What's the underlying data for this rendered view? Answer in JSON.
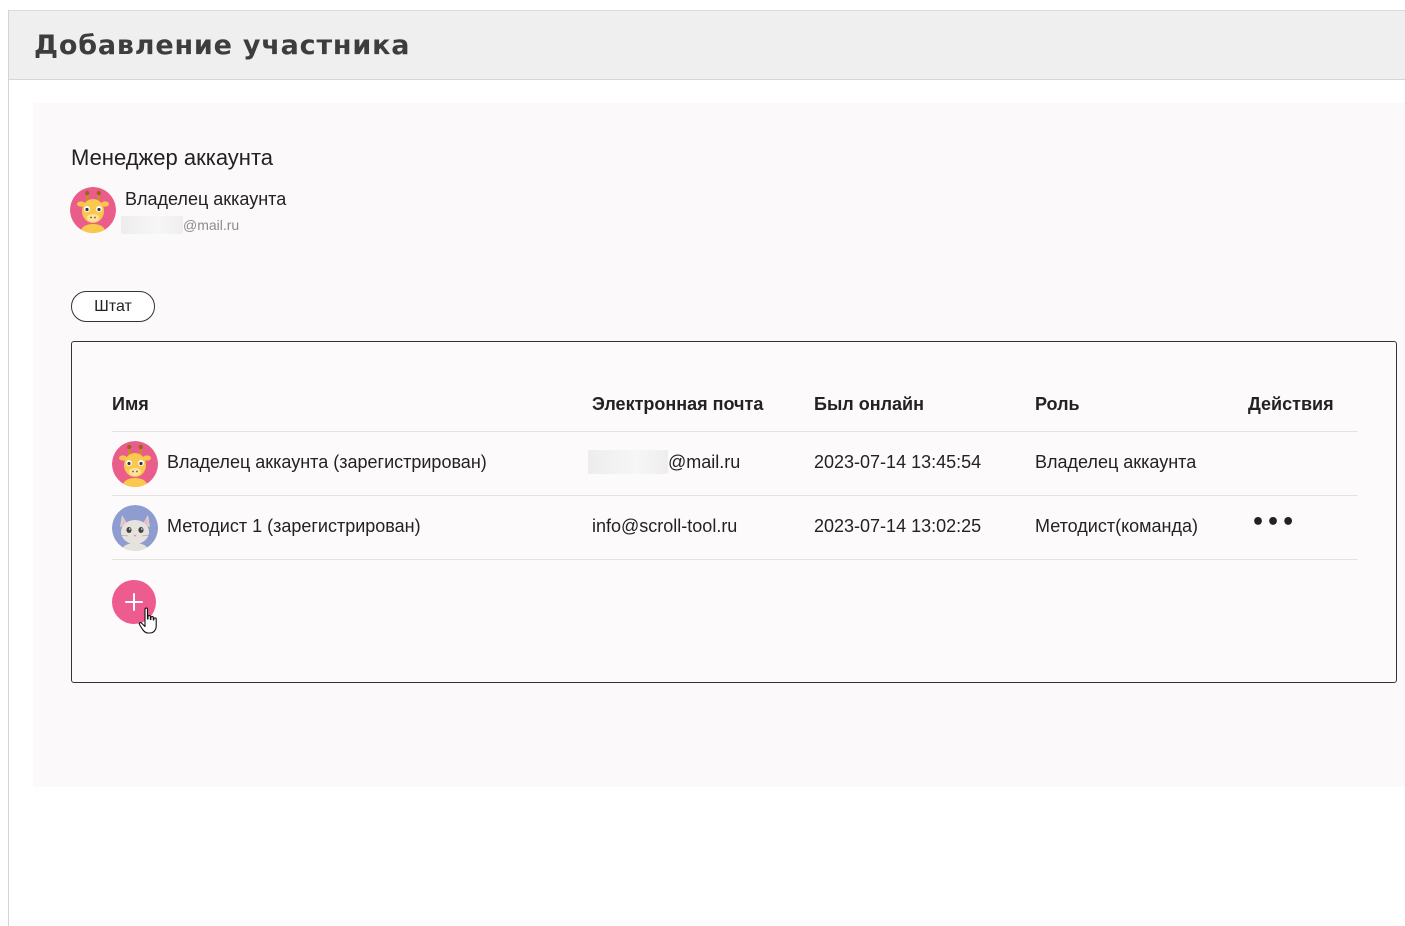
{
  "header": {
    "title": "Добавление участника"
  },
  "manager": {
    "section_title": "Менеджер аккаунта",
    "owner_name": "Владелец аккаунта",
    "owner_email": "@mail.ru"
  },
  "tabs": [
    {
      "label": "Штат"
    }
  ],
  "table": {
    "columns": [
      "Имя",
      "Электронная почта",
      "Был онлайн",
      "Роль",
      "Действия"
    ],
    "rows": [
      {
        "name": "Владелец аккаунта (зарегистрирован)",
        "email": "@mail.ru",
        "last_online": "2023-07-14 13:45:54",
        "role": "Владелец аккаунта",
        "avatar": "giraffe-avatar-icon"
      },
      {
        "name": "Методист 1 (зарегистрирован)",
        "email": "info@scroll-tool.ru",
        "last_online": "2023-07-14 13:02:25",
        "role": "Методист(команда)",
        "avatar": "cat-avatar-icon",
        "actions": "•••"
      }
    ]
  },
  "colors": {
    "accent": "#ee5b8e",
    "panel_bg": "#fcf9fa",
    "header_bg": "#efefef"
  },
  "icons": {
    "add": "plus-icon",
    "cursor": "hand-cursor-icon",
    "actions": "more-dots-icon"
  }
}
